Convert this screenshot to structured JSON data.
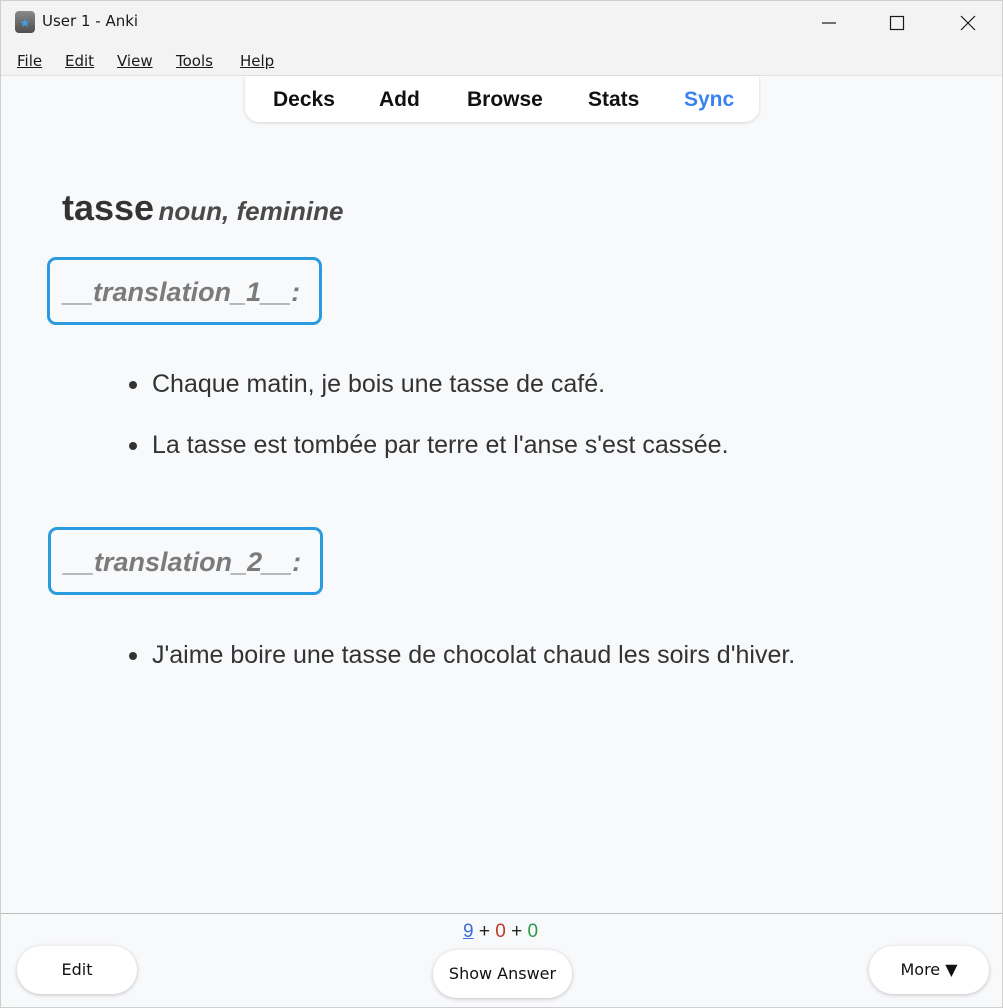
{
  "window": {
    "title": "User 1 - Anki"
  },
  "menu": {
    "items": [
      {
        "label": "File"
      },
      {
        "label": "Edit"
      },
      {
        "label": "View"
      },
      {
        "label": "Tools"
      },
      {
        "label": "Help"
      }
    ]
  },
  "nav": {
    "decks": "Decks",
    "add": "Add",
    "browse": "Browse",
    "stats": "Stats",
    "sync": "Sync",
    "sync_color": "#3b82f0"
  },
  "card": {
    "word": "tasse",
    "part_of_speech": "noun, feminine",
    "translations": [
      {
        "label": "__translation_1__:",
        "examples": [
          "Chaque matin, je bois une tasse de café.",
          "La tasse est tombée par terre et l'anse s'est cassée."
        ]
      },
      {
        "label": "__translation_2__:",
        "examples": [
          "J'aime boire une tasse de chocolat chaud les soirs d'hiver."
        ]
      }
    ],
    "box_border_color": "#2b9be0"
  },
  "counts": {
    "new": "9",
    "plus1": "+",
    "learn": "0",
    "plus2": "+",
    "review": "0"
  },
  "bottom": {
    "edit_label": "Edit",
    "show_answer_label": "Show Answer",
    "more_label": "More ▼"
  }
}
